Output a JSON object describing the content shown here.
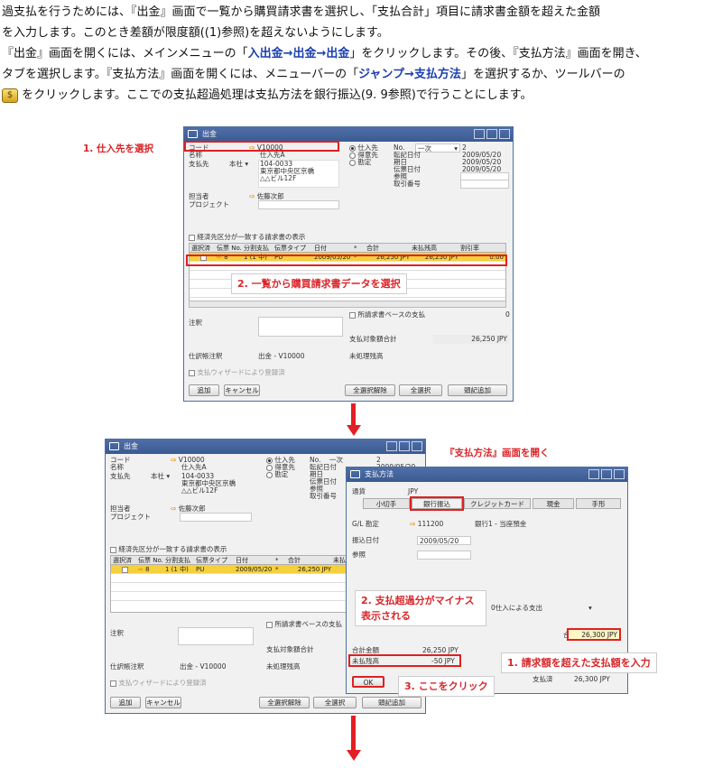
{
  "intro": {
    "l1": "過支払を行うためには、『出金』画面で一覧から購買請求書を選択し、「支払合計」項目に請求書金額を超えた金額",
    "l2": "を入力します。このとき差額が限度額((1)参照)を超えないようにします。",
    "l3a": "『出金』画面を開くには、メインメニューの「",
    "l3b": "入出金→出金→出金",
    "l3c": "」をクリックします。その後、『支払方法』画面を開き、",
    "l4a": "タブを選択します。『支払方法』画面を開くには、メニューバーの「",
    "l4b": "ジャンプ→支払方法",
    "l4c": "」を選択するか、ツールバーの",
    "l5": "をクリックします。ここでの支払超過処理は支払方法を銀行振込(9. 9参照)で行うことにします。"
  },
  "callouts": {
    "select_vendor": "1. 仕入先を選択",
    "select_invoice": "2. 一覧から購買請求書データを選択",
    "open_payment": "『支払方法』画面を開く",
    "minus_shown": "2. 支払超過分がマイナス表示される",
    "enter_amount": "1. 請求額を超えた支払額を入力",
    "click_here": "3. ここをクリック"
  },
  "out": {
    "title": "出金",
    "code_label": "コード",
    "code": "V10000",
    "name_label": "名称",
    "name": "仕入先A",
    "payto_label": "支払先",
    "payto_sel": "本社",
    "addr1": "104-0033",
    "addr2": "東京都中央区京橋",
    "addr3": "△△ビル12F",
    "contact_label": "担当者",
    "contact": "佐藤次郎",
    "project_label": "プロジェクト",
    "r_vendor": "仕入先",
    "r_customer": "得意先",
    "r_account": "勘定",
    "no_label": "No.",
    "no_series": "一次",
    "no_val": "2",
    "post_label": "転記日付",
    "post": "2009/05/20",
    "due_label": "期日",
    "due": "2009/05/20",
    "doc_label": "伝票日付",
    "doc": "2009/05/20",
    "ref_label": "参照",
    "trans_label": "取引番号",
    "show_chk": "経済先区分が一致する請求書の表示",
    "cols": [
      "選択済",
      "伝票 No.",
      "分割支払",
      "伝票タイプ",
      "日付",
      "*",
      "合計",
      "未払残高",
      "割引率"
    ],
    "row": [
      "",
      "8",
      "1 (1 中)",
      "PU",
      "2009/05/20",
      "*",
      "26,250 JPY",
      "26,250 JPY",
      "0.00"
    ],
    "remarks_label": "注釈",
    "inv_base_chk": "所請求書ベースの支払",
    "inv_base_val": "0",
    "total_due_label": "支払対象額合計",
    "total_due": "26,250 JPY",
    "open_bal_label": "未処理残高",
    "journal_label": "仕訳帳注釈",
    "journal": "出金 - V10000",
    "wizard_chk": "支払ウィザードにより登録済",
    "btn_add": "追加",
    "btn_cancel": "キャンセル",
    "btn_deselect": "全選択解除",
    "btn_selall": "全選択",
    "btn_add_doc": "頭記追加"
  },
  "pm": {
    "title": "支払方法",
    "currency_label": "通貨",
    "currency": "JPY",
    "tabs": [
      "小切手",
      "銀行振込",
      "クレジットカード",
      "現金",
      "手形"
    ],
    "gl_label": "G/L 勘定",
    "gl": "111200",
    "gl_name": "銀行1 - 当座預金",
    "transfer_date_label": "振込日付",
    "transfer_date": "2009/05/20",
    "ref_label": "参照",
    "combo": "0仕入による支出",
    "total_label": "合計",
    "total": "26,300 JPY",
    "due_amt_label": "合計金額",
    "due_amt": "26,250 JPY",
    "balance_label": "未払残高",
    "balance": "-50 JPY",
    "paid_label": "支払済",
    "paid": "26,300 JPY",
    "ok": "OK"
  }
}
